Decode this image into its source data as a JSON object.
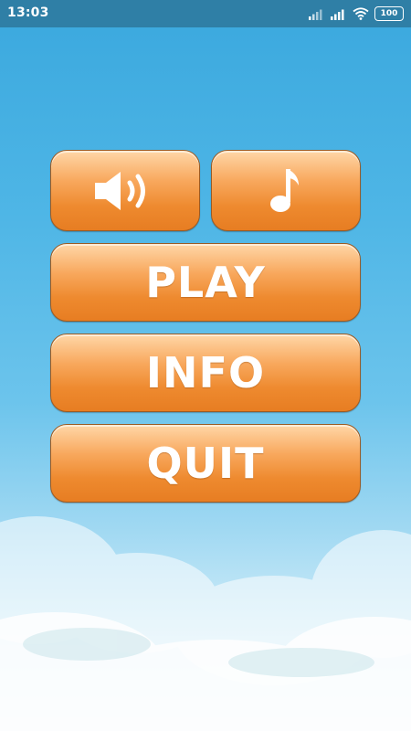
{
  "status_bar": {
    "time": "13:03",
    "battery": "100",
    "icons": [
      "signal-icon",
      "signal-icon",
      "wifi-icon",
      "battery-icon"
    ]
  },
  "menu": {
    "sound_icon": "speaker-volume-icon",
    "music_icon": "music-note-icon",
    "play_label": "PLAY",
    "info_label": "INFO",
    "quit_label": "QUIT"
  },
  "colors": {
    "status_bar": "#2f7fa6",
    "sky_top": "#3aa8de",
    "sky_bottom": "#eef8fc",
    "button_orange": "#ee8a2f",
    "button_highlight": "#ffd7a8",
    "button_border": "#9a5b25",
    "label": "#ffffff"
  }
}
